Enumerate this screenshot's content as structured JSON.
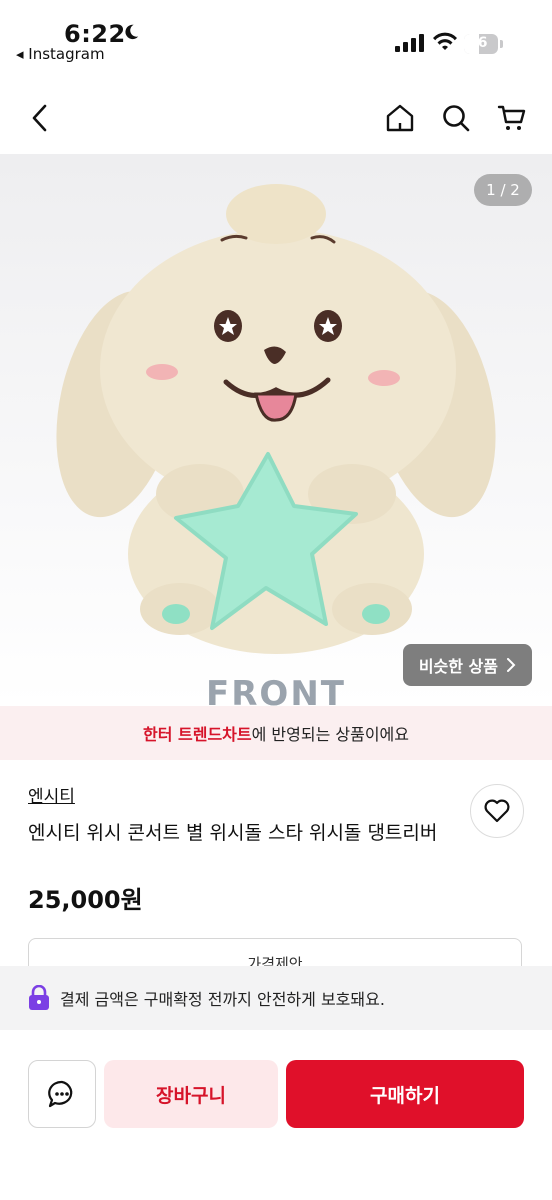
{
  "status_bar": {
    "time": "6:22",
    "back_app": "◂ Instagram",
    "battery": "26"
  },
  "gallery": {
    "counter": "1 / 2",
    "similar_label": "비슷한 상품",
    "front_label": "FRONT"
  },
  "trend": {
    "highlight": "한터 트렌드차트",
    "rest": "에 반영되는 상품이에요"
  },
  "product": {
    "brand": "엔시티",
    "title": "엔시티 위시 콘서트 별 위시돌 스타 위시돌 댕트리버",
    "price": "25,000원",
    "offer_label": "가격제안"
  },
  "safe_notice": "결제 금액은 구매확정 전까지 안전하게 보호돼요.",
  "actions": {
    "cart_label": "장바구니",
    "buy_label": "구매하기"
  },
  "colors": {
    "accent": "#e0102a",
    "accent_soft": "#fde8ea",
    "lock": "#7b3fe4"
  }
}
